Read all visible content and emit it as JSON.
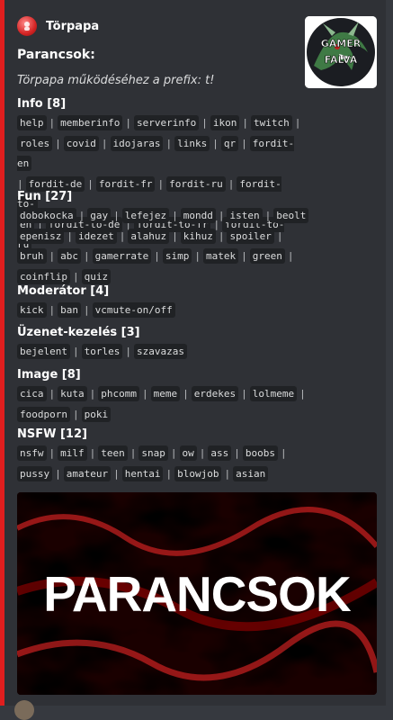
{
  "author": {
    "name": "Törpapa",
    "avatar_icon": "smurf-avatar-icon"
  },
  "thumbnail": {
    "text_line1": "GAMER",
    "text_line2": "FALVA"
  },
  "embed": {
    "accent_color": "#e01e1e",
    "title": "Parancsok:",
    "description": "Törpapa működéséhez a prefix: t!"
  },
  "fields": [
    {
      "name": "Info [8]",
      "lines": [
        [
          "help",
          "memberinfo",
          "serverinfo",
          "ikon",
          "twitch",
          ""
        ],
        [
          "roles",
          "covid",
          "idojaras",
          "links",
          "qr",
          "fordit-en"
        ],
        [
          "",
          "fordit-de",
          "fordit-fr",
          "fordit-ru",
          "fordit-to-"
        ],
        [
          "en",
          "fordit-to-de",
          "fordit-to-fr",
          "fordit-to-ru"
        ]
      ]
    },
    {
      "name": "Fun [27]",
      "lines": [
        [
          "dobokocka",
          "gay",
          "lefejez",
          "mondd",
          "isten",
          "beolt"
        ],
        [
          "epenisz",
          "idezet",
          "alahuz",
          "kihuz",
          "spoiler",
          ""
        ],
        [
          "bruh",
          "abc",
          "gamerrate",
          "simp",
          "matek",
          "green",
          ""
        ],
        [
          "coinflip",
          "quiz"
        ]
      ]
    },
    {
      "name": "Moderátor [4]",
      "lines": [
        [
          "kick",
          "ban",
          "vcmute-on/off"
        ]
      ]
    },
    {
      "name": "Üzenet-kezelés [3]",
      "lines": [
        [
          "bejelent",
          "torles",
          "szavazas"
        ]
      ]
    },
    {
      "name": "Image [8]",
      "lines": [
        [
          "cica",
          "kuta",
          "phcomm",
          "meme",
          "erdekes",
          "lolmeme",
          ""
        ],
        [
          "foodporn",
          "poki"
        ]
      ]
    },
    {
      "name": "NSFW [12]",
      "lines": [
        [
          "nsfw",
          "milf",
          "teen",
          "snap",
          "ow",
          "ass",
          "boobs",
          ""
        ],
        [
          "pussy",
          "amateur",
          "hentai",
          "blowjob",
          "asian"
        ]
      ]
    }
  ],
  "banner": {
    "text": "PARANCSOK"
  }
}
